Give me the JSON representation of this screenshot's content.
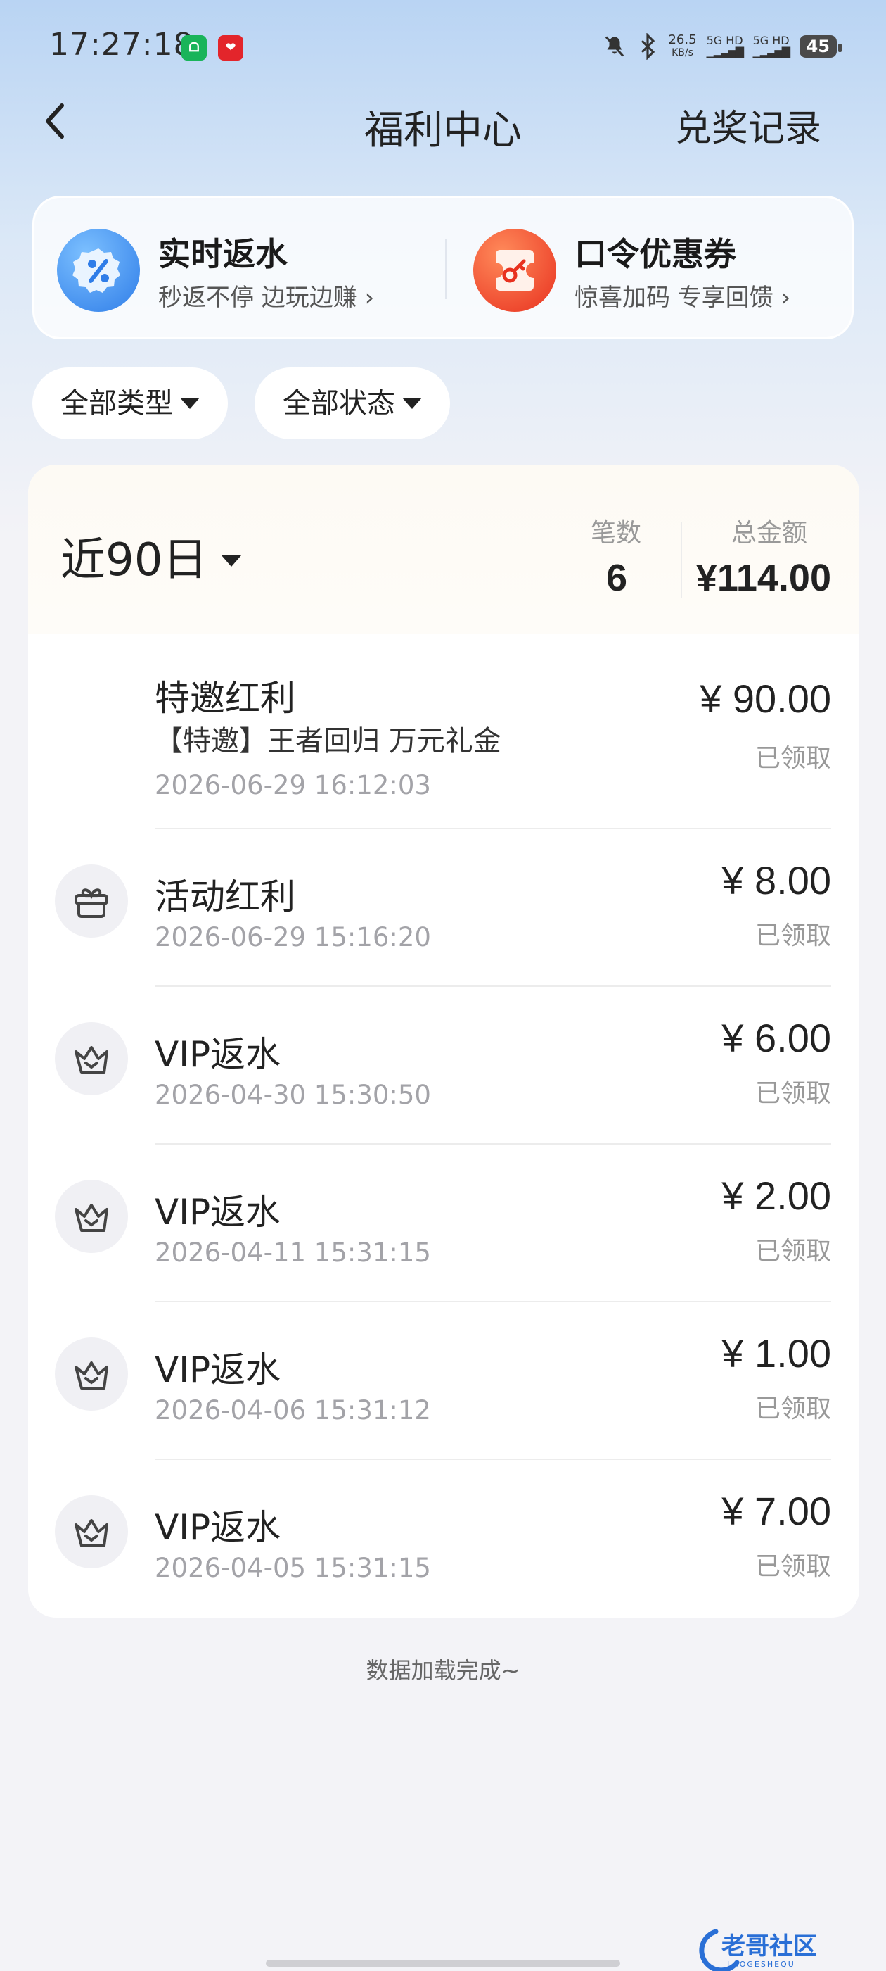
{
  "status_bar": {
    "time": "17:27:18",
    "net_speed_value": "26.5",
    "net_speed_unit": "KB/s",
    "signal1": "5G HD",
    "signal2": "5G HD",
    "battery": "45"
  },
  "nav": {
    "title": "福利中心",
    "right_link": "兑奖记录"
  },
  "promos": [
    {
      "title": "实时返水",
      "subtitle": "秒返不停 边玩边赚",
      "icon": "percent-badge-icon",
      "color": "#3d8bf0"
    },
    {
      "title": "口令优惠券",
      "subtitle": "惊喜加码 专享回馈",
      "icon": "coupon-key-icon",
      "color": "#f04a2e"
    }
  ],
  "filters": {
    "type": "全部类型",
    "status": "全部状态"
  },
  "summary": {
    "period": "近90日",
    "count_label": "笔数",
    "count_value": "6",
    "total_label": "总金额",
    "total_value": "¥114.00"
  },
  "records": [
    {
      "title": "特邀红利",
      "desc": "【特邀】王者回归 万元礼金",
      "time": "2026-06-29 16:12:03",
      "amount": "¥ 90.00",
      "status": "已领取",
      "icon": ""
    },
    {
      "title": "活动红利",
      "desc": "",
      "time": "2026-06-29 15:16:20",
      "amount": "¥ 8.00",
      "status": "已领取",
      "icon": "gift-box-icon"
    },
    {
      "title": "VIP返水",
      "desc": "",
      "time": "2026-04-30 15:30:50",
      "amount": "¥ 6.00",
      "status": "已领取",
      "icon": "crown-icon"
    },
    {
      "title": "VIP返水",
      "desc": "",
      "time": "2026-04-11 15:31:15",
      "amount": "¥ 2.00",
      "status": "已领取",
      "icon": "crown-icon"
    },
    {
      "title": "VIP返水",
      "desc": "",
      "time": "2026-04-06 15:31:12",
      "amount": "¥ 1.00",
      "status": "已领取",
      "icon": "crown-icon"
    },
    {
      "title": "VIP返水",
      "desc": "",
      "time": "2026-04-05 15:31:15",
      "amount": "¥ 7.00",
      "status": "已领取",
      "icon": "crown-icon"
    }
  ],
  "footer": {
    "note": "数据加载完成~"
  },
  "watermark": {
    "text": "老哥社区",
    "sub": "LAOGESHEQU"
  }
}
